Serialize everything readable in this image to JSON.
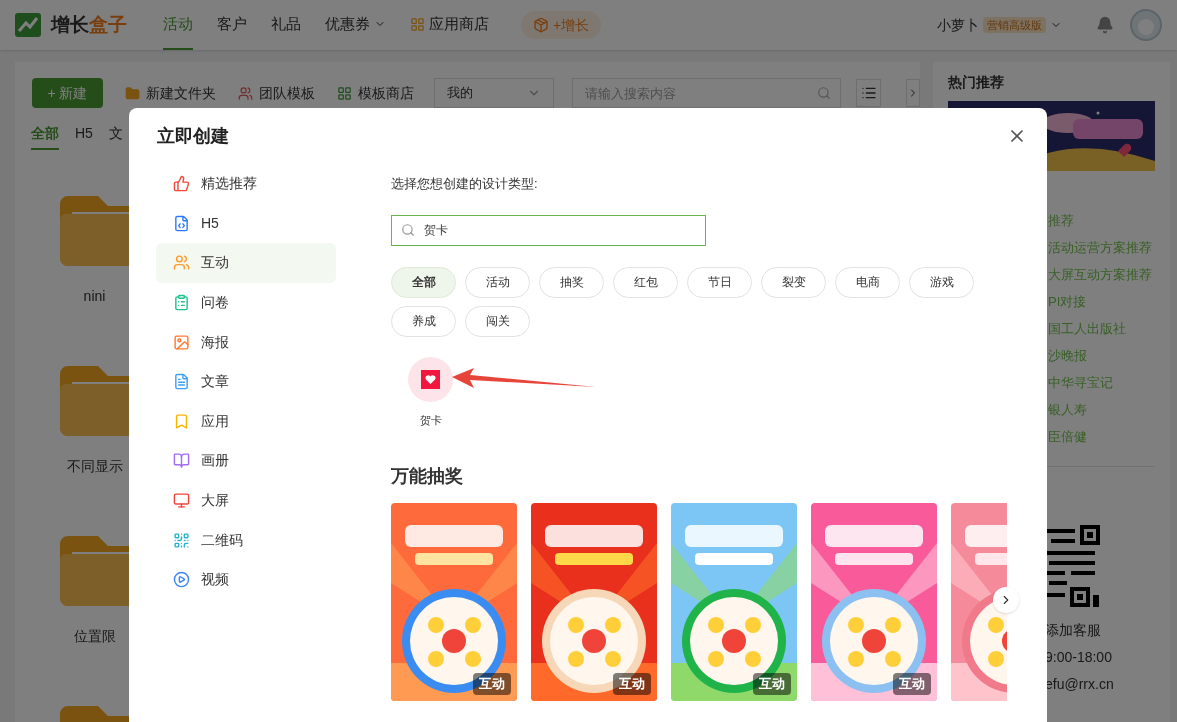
{
  "header": {
    "logo": {
      "parts": [
        "增长",
        "盒子"
      ]
    },
    "nav": [
      {
        "label": "活动",
        "selected": true,
        "kind": "plain"
      },
      {
        "label": "客户",
        "selected": false,
        "kind": "plain"
      },
      {
        "label": "礼品",
        "selected": false,
        "kind": "plain"
      },
      {
        "label": "优惠券",
        "selected": false,
        "kind": "dropdown"
      },
      {
        "label": "应用商店",
        "selected": false,
        "kind": "store"
      }
    ],
    "grow_button": "+增长",
    "user": {
      "name": "小萝卜",
      "plan": "营销高级版"
    }
  },
  "toolbar": {
    "new_button": "+ 新建",
    "actions": [
      "新建文件夹",
      "团队模板",
      "模板商店"
    ],
    "filter": "我的",
    "search": {
      "placeholder": "请输入搜索内容"
    }
  },
  "tabs": [
    {
      "label": "全部",
      "selected": true
    },
    {
      "label": "H5",
      "selected": false
    },
    {
      "label": "文",
      "selected": false
    }
  ],
  "folders": [
    {
      "label": "nini"
    },
    {
      "label": "不同显示"
    },
    {
      "label": "位置限"
    }
  ],
  "side_panel": {
    "title": "热门推荐",
    "links": [
      "推荐",
      "活动运营方案推荐",
      "大屏互动方案推荐",
      "PI对接",
      "国工人出版社",
      "沙晚报",
      "中华寻宝记",
      "银人寿",
      "臣倍健"
    ],
    "contact": [
      "添加客服",
      "9:00-18:00",
      "efu@rrx.cn"
    ]
  },
  "dialog": {
    "title": "立即创建",
    "menu": [
      {
        "label": "精选推荐",
        "selected": false
      },
      {
        "label": "H5",
        "selected": false
      },
      {
        "label": "互动",
        "selected": true
      },
      {
        "label": "问卷",
        "selected": false
      },
      {
        "label": "海报",
        "selected": false
      },
      {
        "label": "文章",
        "selected": false
      },
      {
        "label": "应用",
        "selected": false
      },
      {
        "label": "画册",
        "selected": false
      },
      {
        "label": "大屏",
        "selected": false
      },
      {
        "label": "二维码",
        "selected": false
      },
      {
        "label": "视频",
        "selected": false
      }
    ],
    "prompt": "选择您想创建的设计类型:",
    "search": {
      "value": "贺卡"
    },
    "chips": [
      {
        "label": "全部",
        "selected": true
      },
      {
        "label": "活动",
        "selected": false
      },
      {
        "label": "抽奖",
        "selected": false
      },
      {
        "label": "红包",
        "selected": false
      },
      {
        "label": "节日",
        "selected": false
      },
      {
        "label": "裂变",
        "selected": false
      },
      {
        "label": "电商",
        "selected": false
      },
      {
        "label": "游戏",
        "selected": false
      },
      {
        "label": "养成",
        "selected": false
      },
      {
        "label": "闯关",
        "selected": false
      }
    ],
    "results": [
      {
        "label": "贺卡"
      }
    ],
    "section": {
      "title": "万能抽奖",
      "templates": [
        {
          "tag": "互动"
        },
        {
          "tag": "互动"
        },
        {
          "tag": "互动"
        },
        {
          "tag": "互动"
        }
      ]
    }
  }
}
